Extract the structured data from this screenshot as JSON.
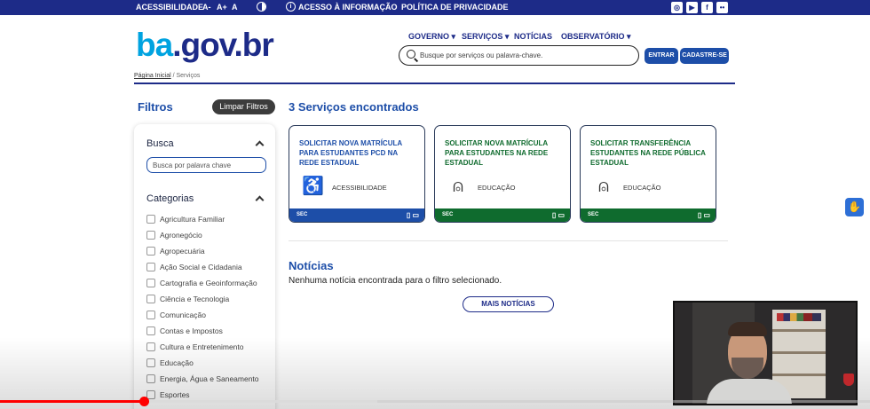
{
  "topbar": {
    "acessibilidade": "ACESSIBILIDADE",
    "font_minus": "A-",
    "font_plus": "A+",
    "font_reset": "A",
    "acesso_info": "ACESSO À INFORMAÇÃO",
    "privacidade": "POLÍTICA DE PRIVACIDADE",
    "social_icons": [
      "instagram-icon",
      "youtube-icon",
      "facebook-icon",
      "flickr-icon"
    ]
  },
  "header": {
    "logo_part1": "ba",
    "logo_part2": ".gov.br",
    "nav": {
      "governo": "GOVERNO",
      "servicos": "SERVIÇOS",
      "noticias": "NOTÍCIAS",
      "observatorio": "OBSERVATÓRIO"
    },
    "search_placeholder": "Busque por serviços ou palavra-chave.",
    "entrar": "ENTRAR",
    "cadastre": "CADASTRE-SE"
  },
  "breadcrumb": {
    "home": "Página Inicial",
    "separator": "/",
    "current": "Serviços"
  },
  "sidebar": {
    "title": "Filtros",
    "clear_label": "Limpar Filtros",
    "busca_title": "Busca",
    "busca_placeholder": "Busca por palavra chave",
    "categorias_title": "Categorias",
    "categories": [
      "Agricultura Familiar",
      "Agronegócio",
      "Agropecuária",
      "Ação Social e Cidadania",
      "Cartografia e Geoinformação",
      "Ciência e Tecnologia",
      "Comunicação",
      "Contas e Impostos",
      "Cultura e Entretenimento",
      "Educação",
      "Energia, Água e Saneamento",
      "Esportes"
    ]
  },
  "results": {
    "title": "3 Serviços encontrados",
    "cards": [
      {
        "title": "SOLICITAR NOVA MATRÍCULA PARA ESTUDANTES PCD NA REDE ESTADUAL",
        "category": "ACESSIBILIDADE",
        "icon": "wheelchair-icon",
        "org": "SEC",
        "color": "#1d4ea8"
      },
      {
        "title": "SOLICITAR NOVA MATRÍCULA PARA ESTUDANTES NA REDE ESTADUAL",
        "category": "EDUCAÇÃO",
        "icon": "student-icon",
        "org": "SEC",
        "color": "#0f6b2e"
      },
      {
        "title": "SOLICITAR TRANSFERÊNCIA ESTUDANTES NA REDE PÚBLICA ESTADUAL",
        "category": "EDUCAÇÃO",
        "icon": "student-icon",
        "org": "SEC",
        "color": "#0f6b2e"
      }
    ]
  },
  "news": {
    "title": "Notícias",
    "empty": "Nenhuma notícia encontrada para o filtro selecionado.",
    "more": "MAIS NOTÍCIAS"
  },
  "video": {
    "progress_fraction": 0.165,
    "buffered_fraction": 0.434
  }
}
